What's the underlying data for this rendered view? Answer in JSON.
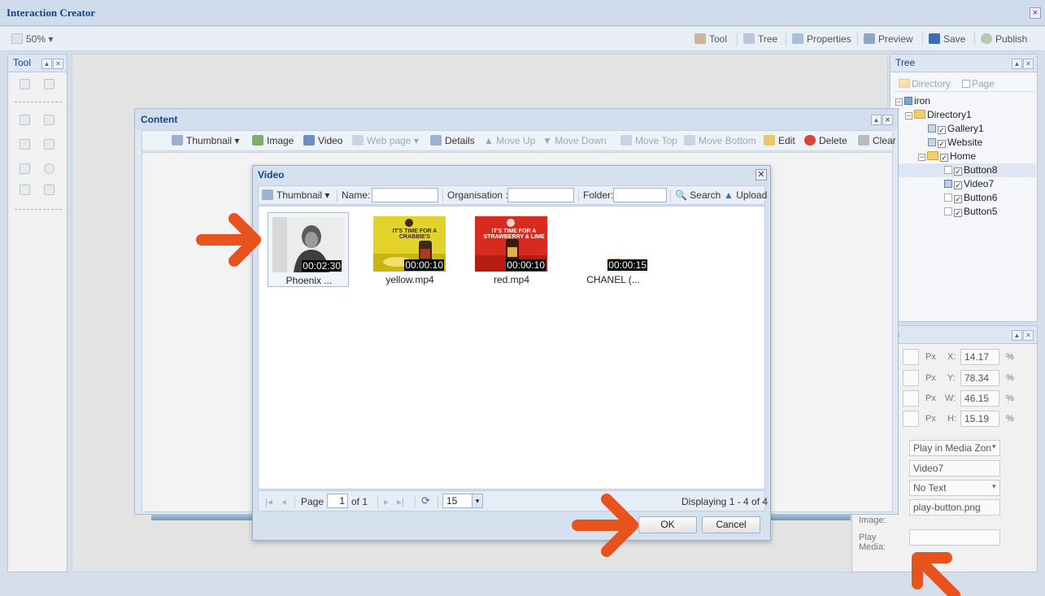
{
  "window": {
    "title": "Interaction Creator",
    "close": "×"
  },
  "toolbar": {
    "zoom": "50%",
    "tool": "Tool",
    "tree": "Tree",
    "properties": "Properties",
    "preview": "Preview",
    "save": "Save",
    "publish": "Publish"
  },
  "tool_panel": {
    "title": "Tool"
  },
  "tree_panel": {
    "title": "Tree",
    "directory_btn": "Directory",
    "page_btn": "Page",
    "nodes": {
      "root": "iron",
      "dir1": "Directory1",
      "gallery": "Gallery1",
      "website": "Website",
      "home": "Home",
      "button8": "Button8",
      "video7": "Video7",
      "button6": "Button6",
      "button5": "Button5"
    }
  },
  "props_panel": {
    "title": "s",
    "px": "Px",
    "pct": "%",
    "x_label": "X:",
    "x": "14.17",
    "y_label": "Y:",
    "y": "78.34",
    "w_label": "W:",
    "w": "46.15",
    "h_label": "H:",
    "h": "15.19",
    "action": "Play in Media Zon",
    "target": "Video7",
    "text_mode": "No Text",
    "image": "play-button.png",
    "image_label": "Image:",
    "play_media_label": "Play Media:",
    "play_media": ""
  },
  "content": {
    "title": "Content",
    "toolbar": {
      "thumbnail": "Thumbnail",
      "image": "Image",
      "video": "Video",
      "webpage": "Web page",
      "details": "Details",
      "move_up": "Move Up",
      "move_down": "Move Down",
      "move_top": "Move Top",
      "move_bottom": "Move Bottom",
      "edit": "Edit",
      "delete": "Delete",
      "clear": "Clear"
    }
  },
  "video_dialog": {
    "title": "Video",
    "thumbnail": "Thumbnail",
    "name_label": "Name:",
    "org_label": "Organisation :",
    "folder_label": "Folder:",
    "search": "Search",
    "upload": "Upload",
    "videos": [
      {
        "name": "Phoenix ...",
        "duration": "00:02:30"
      },
      {
        "name": "yellow.mp4",
        "duration": "00:00:10"
      },
      {
        "name": "red.mp4",
        "duration": "00:00:10"
      },
      {
        "name": "CHANEL (...",
        "duration": "00:00:15"
      }
    ],
    "thumb_text": {
      "yellow": "IT'S TIME FOR A CRABBIE'S",
      "red": "IT'S TIME FOR A STRAWBERRY & LIME"
    },
    "pager": {
      "page_label": "Page",
      "page": "1",
      "of": "of 1",
      "page_size": "15",
      "displaying": "Displaying 1 - 4 of 4"
    },
    "ok": "OK",
    "cancel": "Cancel"
  },
  "colors": {
    "arrow": "#e8531d",
    "title": "#15428b"
  }
}
